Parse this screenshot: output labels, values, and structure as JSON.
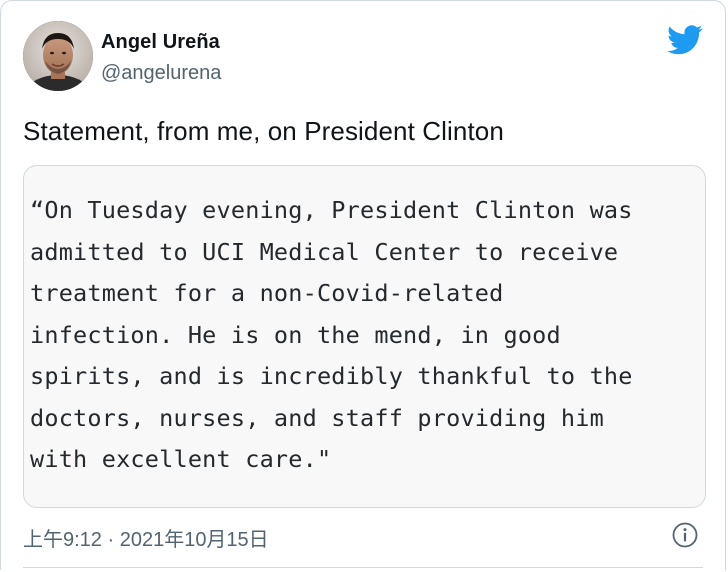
{
  "author": {
    "name": "Angel Ureña",
    "handle": "@angelurena",
    "avatar": "profile-photo"
  },
  "tweet": {
    "text": "Statement, from me, on President Clinton",
    "statement_image_text": "“On Tuesday evening, President Clinton was\nadmitted to UCI Medical Center to receive\ntreatment for a non-Covid-related\ninfection. He is on the mend, in good\nspirits, and is incredibly thankful to the\ndoctors, nurses, and staff providing him\nwith excellent care.\"",
    "timestamp": "上午9:12 · 2021年10月15日"
  },
  "icons": {
    "logo": "twitter-bird-icon",
    "info": "info-icon"
  },
  "colors": {
    "brand": "#1d9bf0",
    "text_primary": "#0f1419",
    "text_secondary": "#536471",
    "border": "#cfd9de"
  }
}
